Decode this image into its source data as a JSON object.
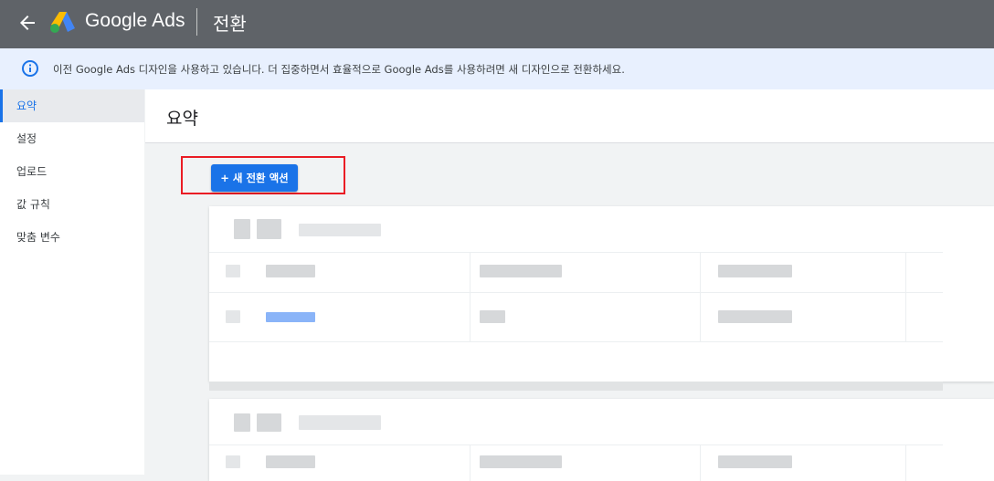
{
  "header": {
    "brand": "Google Ads",
    "page_title": "전환"
  },
  "banner": {
    "text": "이전 Google Ads 디자인을 사용하고 있습니다. 더 집중하면서 효율적으로 Google Ads를 사용하려면 새 디자인으로 전환하세요."
  },
  "sidebar": {
    "items": [
      {
        "label": "요약",
        "active": true
      },
      {
        "label": "설정"
      },
      {
        "label": "업로드"
      },
      {
        "label": "값 규칙"
      },
      {
        "label": "맞춤 변수"
      }
    ]
  },
  "main": {
    "title": "요약",
    "new_action_button": "+ 새 전환 액션"
  },
  "colors": {
    "topbar": "#5f6368",
    "accent": "#1a73e8",
    "highlight_box": "#ea1c24",
    "banner_bg": "#e8f0fe"
  },
  "icons": [
    "back-arrow-icon",
    "google-ads-logo-icon",
    "info-icon"
  ]
}
